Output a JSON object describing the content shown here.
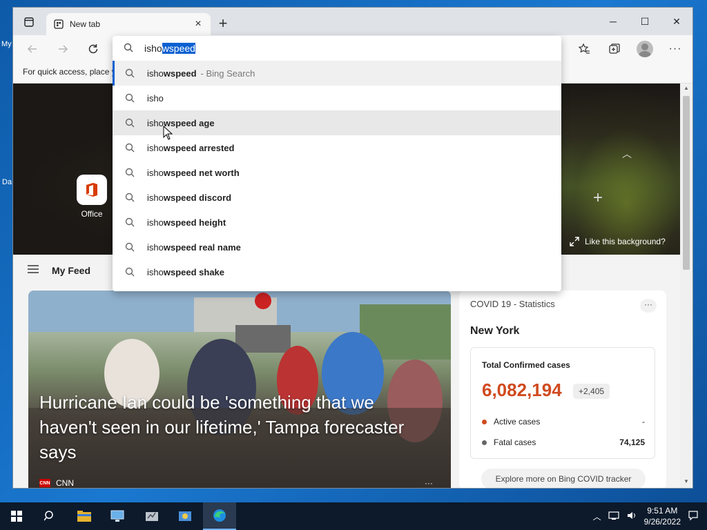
{
  "desktop": {
    "label_top": "My",
    "label_mid": "Da"
  },
  "browser": {
    "tab": {
      "title": "New tab"
    },
    "window_controls": {
      "minimize": "─",
      "maximize": "☐",
      "close": "✕"
    },
    "favorites_bar": {
      "text": "For quick access, place y"
    }
  },
  "omnibox": {
    "typed_prefix": "isho",
    "typed_selection": "wspeed",
    "suggestions": [
      {
        "prefix": "isho",
        "bold": "wspeed",
        "hint": "- Bing Search",
        "state": "active"
      },
      {
        "prefix": "isho",
        "bold": "",
        "hint": "",
        "state": ""
      },
      {
        "prefix": "isho",
        "bold": "wspeed age",
        "hint": "",
        "state": "hover"
      },
      {
        "prefix": "isho",
        "bold": "wspeed arrested",
        "hint": "",
        "state": ""
      },
      {
        "prefix": "isho",
        "bold": "wspeed net worth",
        "hint": "",
        "state": ""
      },
      {
        "prefix": "isho",
        "bold": "wspeed discord",
        "hint": "",
        "state": ""
      },
      {
        "prefix": "isho",
        "bold": "wspeed height",
        "hint": "",
        "state": ""
      },
      {
        "prefix": "isho",
        "bold": "wspeed real name",
        "hint": "",
        "state": ""
      },
      {
        "prefix": "isho",
        "bold": "wspeed shake",
        "hint": "",
        "state": ""
      }
    ]
  },
  "hero": {
    "office_label": "Office",
    "like_background": "Like this background?"
  },
  "feed": {
    "title": "My Feed"
  },
  "news": {
    "headline": "Hurricane Ian could be 'something that we haven't seen in our lifetime,' Tampa forecaster says",
    "source": "CNN",
    "more": "···"
  },
  "covid": {
    "title": "COVID 19 - Statistics",
    "more": "···",
    "region": "New York",
    "total_label": "Total Confirmed cases",
    "total_value": "6,082,194",
    "delta": "+2,405",
    "active_label": "Active cases",
    "active_value": "-",
    "fatal_label": "Fatal cases",
    "fatal_value": "74,125",
    "link": "Explore more on Bing COVID tracker",
    "colors": {
      "active": "#d04a1f",
      "fatal": "#666666",
      "total": "#d04a1f"
    }
  },
  "taskbar": {
    "time": "9:51 AM",
    "date": "9/26/2022"
  }
}
